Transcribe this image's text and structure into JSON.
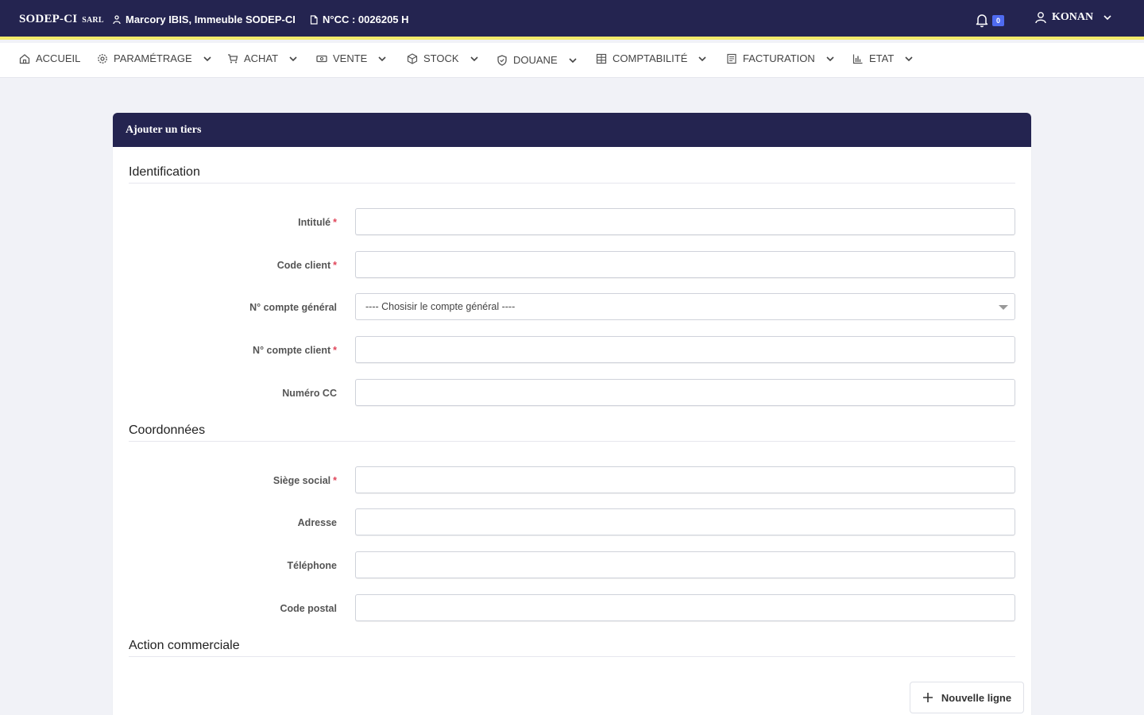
{
  "topbar": {
    "brand": "SODEP-CI",
    "brand_suffix": "SARL",
    "location": "Marcory IBIS, Immeuble SODEP-CI",
    "ncc": "N°CC : 0026205 H",
    "notifications_count": "0",
    "user": "KONAN"
  },
  "nav": {
    "items": [
      {
        "label": "ACCUEIL",
        "icon": "home-icon"
      },
      {
        "label": "PARAMÉTRAGE",
        "icon": "gear-icon"
      },
      {
        "label": "ACHAT",
        "icon": "cart-icon"
      },
      {
        "label": "VENTE",
        "icon": "money-icon"
      },
      {
        "label": "STOCK",
        "icon": "box-icon"
      },
      {
        "label": "DOUANE",
        "icon": "shield-icon"
      },
      {
        "label": "COMPTABILITÉ",
        "icon": "grid-icon"
      },
      {
        "label": "FACTURATION",
        "icon": "invoice-icon"
      },
      {
        "label": "ETAT",
        "icon": "bar-chart-icon"
      }
    ]
  },
  "card": {
    "title": "Ajouter un tiers",
    "sections": {
      "identification": "Identification",
      "coordonnees": "Coordonnées",
      "action": "Action commerciale"
    },
    "fields": {
      "intitule": {
        "label": "Intitulé",
        "value": ""
      },
      "code_client": {
        "label": "Code client",
        "value": ""
      },
      "compte_general": {
        "label": "N° compte général",
        "selected": "---- Chosisir le compte général ----"
      },
      "compte_client": {
        "label": "N° compte client",
        "value": ""
      },
      "numero_cc": {
        "label": "Numéro CC",
        "value": ""
      },
      "siege_social": {
        "label": "Siège social",
        "value": ""
      },
      "adresse": {
        "label": "Adresse",
        "value": ""
      },
      "telephone": {
        "label": "Téléphone",
        "value": ""
      },
      "code_postal": {
        "label": "Code postal",
        "value": ""
      }
    },
    "required_marker": "*",
    "add_line_label": "Nouvelle ligne"
  }
}
